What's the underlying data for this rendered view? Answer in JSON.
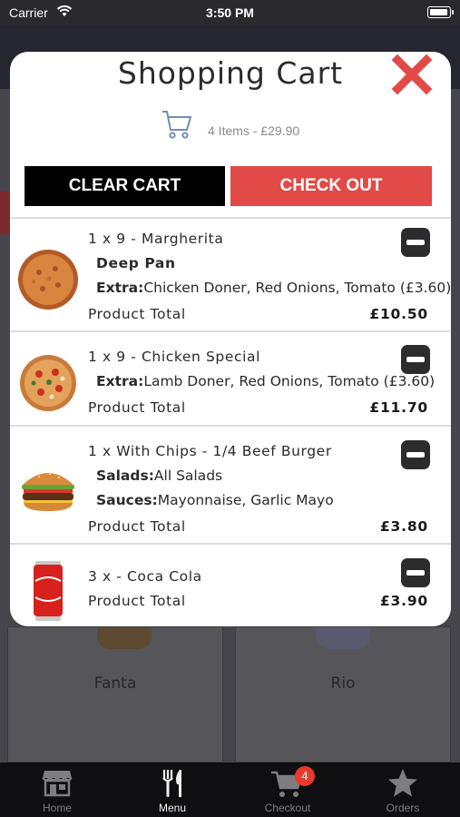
{
  "status_bar": {
    "carrier": "Carrier",
    "time": "3:50 PM"
  },
  "background": {
    "cards": [
      {
        "label": "Fanta"
      },
      {
        "label": "Rio"
      }
    ]
  },
  "cart_modal": {
    "title": "Shopping Cart",
    "summary": "4 Items - £29.90",
    "clear_label": "CLEAR CART",
    "checkout_label": "CHECK OUT",
    "items": [
      {
        "title": "1 x 9 - Margherita",
        "details": [
          {
            "label": "Deep Pan",
            "value": ""
          },
          {
            "label": "Extra:",
            "value": "Chicken Doner, Red Onions, Tomato (£3.60)"
          }
        ],
        "total_label": "Product Total",
        "total": "£10.50"
      },
      {
        "title": "1 x 9 - Chicken Special",
        "details": [
          {
            "label": "Extra:",
            "value": "Lamb Doner, Red Onions, Tomato (£3.60)"
          }
        ],
        "total_label": "Product Total",
        "total": "£11.70"
      },
      {
        "title": "1 x With Chips - 1/4 Beef Burger",
        "details": [
          {
            "label": "Salads:",
            "value": "All Salads"
          },
          {
            "label": "Sauces:",
            "value": "Mayonnaise, Garlic Mayo"
          }
        ],
        "total_label": "Product Total",
        "total": "£3.80"
      },
      {
        "title": "3 x - Coca Cola",
        "details": [],
        "total_label": "Product Total",
        "total": "£3.90"
      }
    ]
  },
  "tabbar": {
    "tabs": [
      {
        "label": "Home",
        "icon": "store-icon"
      },
      {
        "label": "Menu",
        "icon": "fork-knife-icon"
      },
      {
        "label": "Checkout",
        "icon": "cart-icon",
        "badge": "4"
      },
      {
        "label": "Orders",
        "icon": "star-icon"
      }
    ]
  },
  "colors": {
    "accent": "#e24a47",
    "clear_button": "#000000",
    "badge": "#e8392b",
    "close_icon": "#e24a47"
  }
}
